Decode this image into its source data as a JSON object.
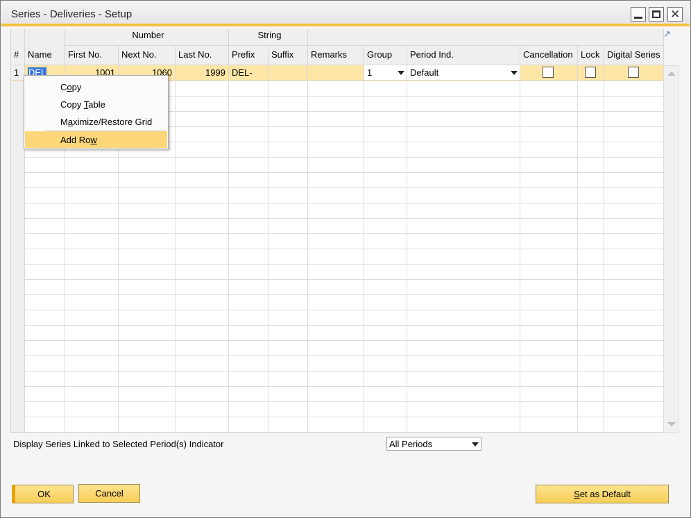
{
  "window": {
    "title": "Series - Deliveries - Setup"
  },
  "grid": {
    "group_headers": {
      "number": "Number",
      "string": "String"
    },
    "columns": {
      "num": "#",
      "name": "Name",
      "first_no": "First No.",
      "next_no": "Next No.",
      "last_no": "Last No.",
      "prefix": "Prefix",
      "suffix": "Suffix",
      "remarks": "Remarks",
      "group": "Group",
      "period_ind": "Period Ind.",
      "cancellation": "Cancellation",
      "lock": "Lock",
      "digital_series": "Digital Series"
    },
    "rows": [
      {
        "num": "1",
        "name": "DEL",
        "first_no": "1001",
        "next_no": "1060",
        "last_no": "1999",
        "prefix": "DEL-",
        "suffix": "",
        "remarks": "",
        "group": "1",
        "period_ind": "Default",
        "cancellation": false,
        "lock": false,
        "digital_series": false
      }
    ]
  },
  "context_menu": {
    "copy": {
      "before": "C",
      "ul": "o",
      "after": "py"
    },
    "copy_table": {
      "before": "Copy ",
      "ul": "T",
      "after": "able"
    },
    "maximize": {
      "before": "M",
      "ul": "a",
      "after": "ximize/Restore Grid"
    },
    "add_row": {
      "before": "Add Ro",
      "ul": "w",
      "after": ""
    }
  },
  "footer": {
    "period_label": "Display Series Linked to Selected Period(s) Indicator",
    "period_select_value": "All Periods",
    "ok_label": "OK",
    "cancel_label": "Cancel",
    "set_default": {
      "before": "",
      "ul": "S",
      "after": "et as Default"
    }
  }
}
